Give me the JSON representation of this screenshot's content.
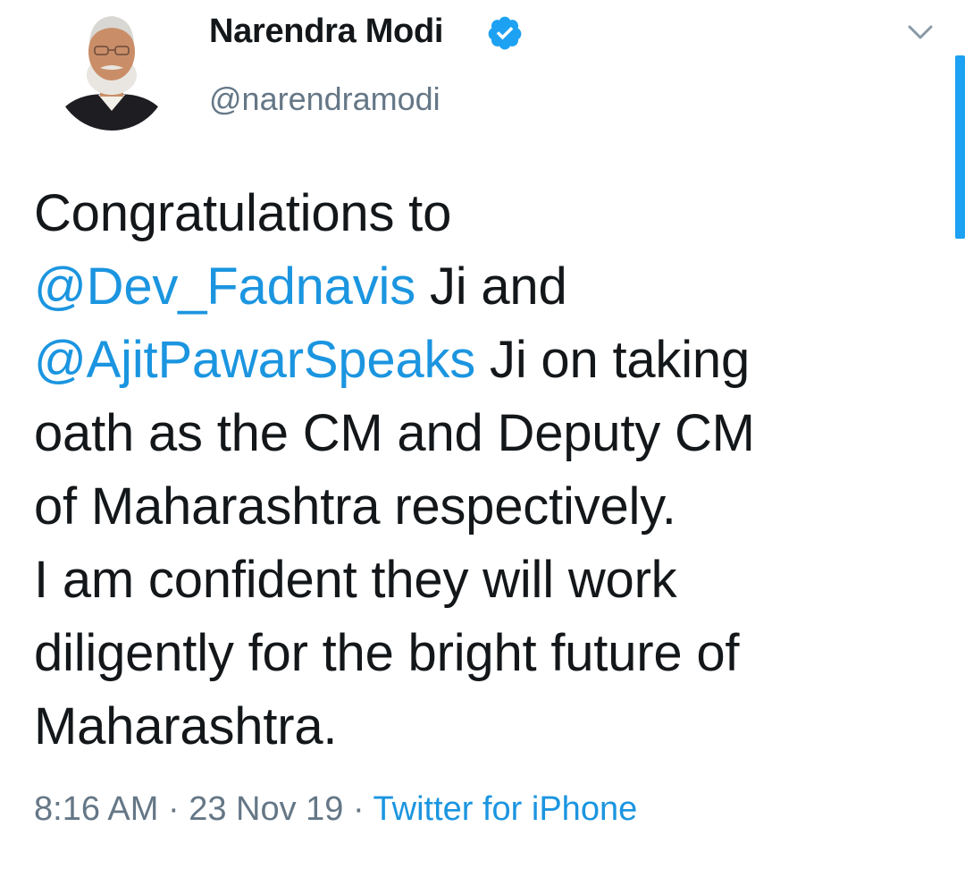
{
  "tweet": {
    "author": {
      "display_name": "Narendra Modi",
      "handle": "@narendramodi",
      "verified": true,
      "avatar_icon": "avatar-photo"
    },
    "text": {
      "line1": "Congratulations to",
      "mention1": "@Dev_Fadnavis",
      "line2_rest": " Ji and",
      "mention2": "@AjitPawarSpeaks",
      "line3_rest": " Ji on taking",
      "line4": "oath as the CM and Deputy CM",
      "line5": "of Maharashtra respectively.",
      "line6": "I am confident they will work",
      "line7": "diligently for the bright future of",
      "line8": "Maharashtra."
    },
    "meta": {
      "time": "8:16 AM",
      "separator": " · ",
      "date": "23 Nov 19",
      "source": "Twitter for iPhone"
    },
    "icons": {
      "verified": "verified-badge-icon",
      "menu": "chevron-down-icon"
    },
    "colors": {
      "link": "#1b95e0",
      "secondary": "#657786",
      "text": "#14171a",
      "verified": "#1da1f2"
    }
  }
}
